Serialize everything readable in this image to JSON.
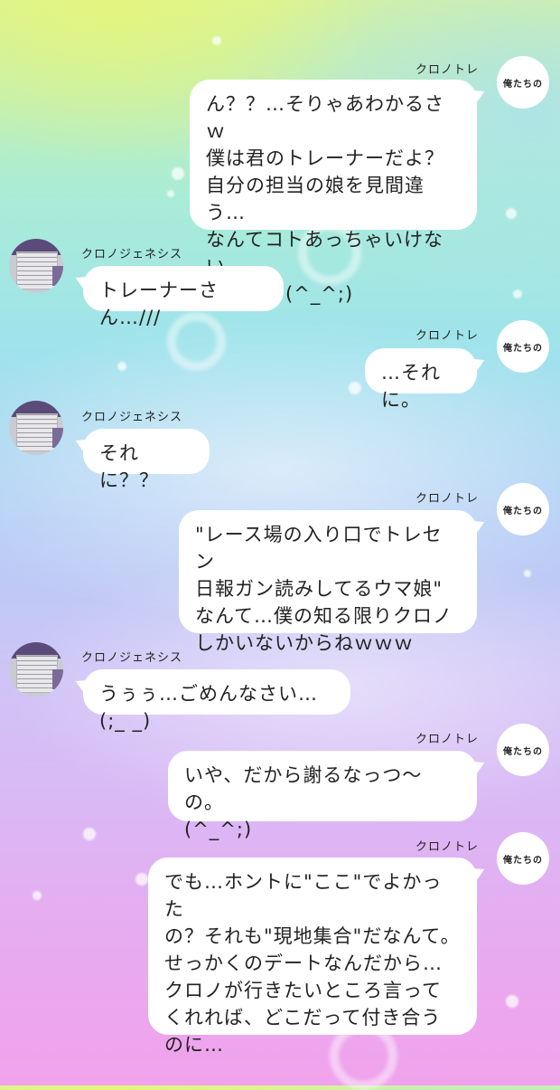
{
  "messages": [
    {
      "sender": "クロノトレ",
      "side": "right",
      "avatar_label": "俺たちの",
      "text": "ん？？…そりゃあわかるさｗ\n僕は君のトレーナーだよ？\n自分の担当の娘を見間違う…\nなんてコトあっちゃいけない\nでしょ。(^_^;)"
    },
    {
      "sender": "クロノジェネシス",
      "side": "left",
      "text": "トレーナーさん…///"
    },
    {
      "sender": "クロノトレ",
      "side": "right",
      "avatar_label": "俺たちの",
      "text": "…それに。"
    },
    {
      "sender": "クロノジェネシス",
      "side": "left",
      "text": "それに？？"
    },
    {
      "sender": "クロノトレ",
      "side": "right",
      "avatar_label": "俺たちの",
      "text": "\"レース場の入り口でトレセン\n日報ガン読みしてるウマ娘\"\nなんて…僕の知る限りクロノ\nしかいないからねｗｗｗ"
    },
    {
      "sender": "クロノジェネシス",
      "side": "left",
      "text": "うぅぅ…ごめんなさい…(;_ _)"
    },
    {
      "sender": "クロノトレ",
      "side": "right",
      "avatar_label": "俺たちの",
      "text": "いや、だから謝るなっつ〜の。\n(^_^;)"
    },
    {
      "sender": "クロノトレ",
      "side": "right",
      "avatar_label": "俺たちの",
      "text": "でも…ホントに\"ここ\"でよかった\nの？それも\"現地集合\"だなんて。\nせっかくのデートなんだから…\nクロノが行きたいところ言って\nくれれば、どこだって付き合う\nのに…"
    }
  ]
}
